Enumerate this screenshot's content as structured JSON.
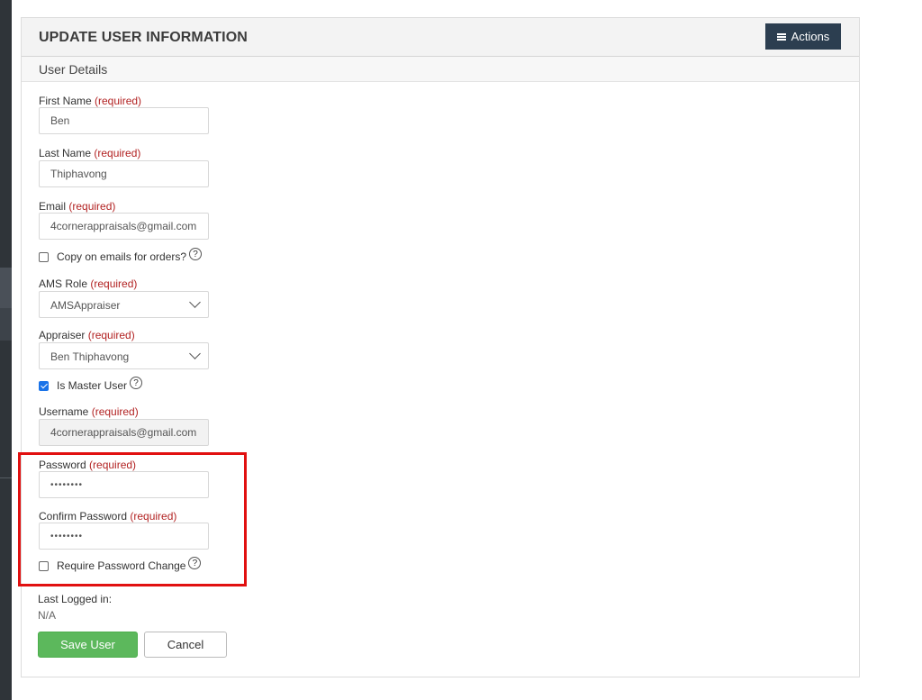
{
  "panel": {
    "title": "UPDATE USER INFORMATION",
    "actions_label": "Actions",
    "section_title": "User Details"
  },
  "form": {
    "required_text": "(required)",
    "first_name": {
      "label": "First Name",
      "value": "Ben"
    },
    "last_name": {
      "label": "Last Name",
      "value": "Thiphavong"
    },
    "email": {
      "label": "Email",
      "value": "4cornerappraisals@gmail.com"
    },
    "copy_emails": {
      "label": "Copy on emails for orders?",
      "checked": false
    },
    "ams_role": {
      "label": "AMS Role",
      "value": "AMSAppraiser"
    },
    "appraiser": {
      "label": "Appraiser",
      "value": "Ben Thiphavong"
    },
    "is_master": {
      "label": "Is Master User",
      "checked": true
    },
    "username": {
      "label": "Username",
      "value": "4cornerappraisals@gmail.com"
    },
    "password": {
      "label": "Password",
      "value": "••••••••"
    },
    "confirm_password": {
      "label": "Confirm Password",
      "value": "••••••••"
    },
    "require_change": {
      "label": "Require Password Change",
      "checked": false
    },
    "last_logged": {
      "label": "Last Logged in:",
      "value": "N/A"
    },
    "help_glyph": "?"
  },
  "buttons": {
    "save": "Save User",
    "cancel": "Cancel"
  },
  "colors": {
    "actions_bg": "#2c3e50",
    "save_bg": "#5cb85c",
    "required": "#b22222",
    "highlight": "#e11010",
    "checkbox_on": "#1a73e8"
  }
}
